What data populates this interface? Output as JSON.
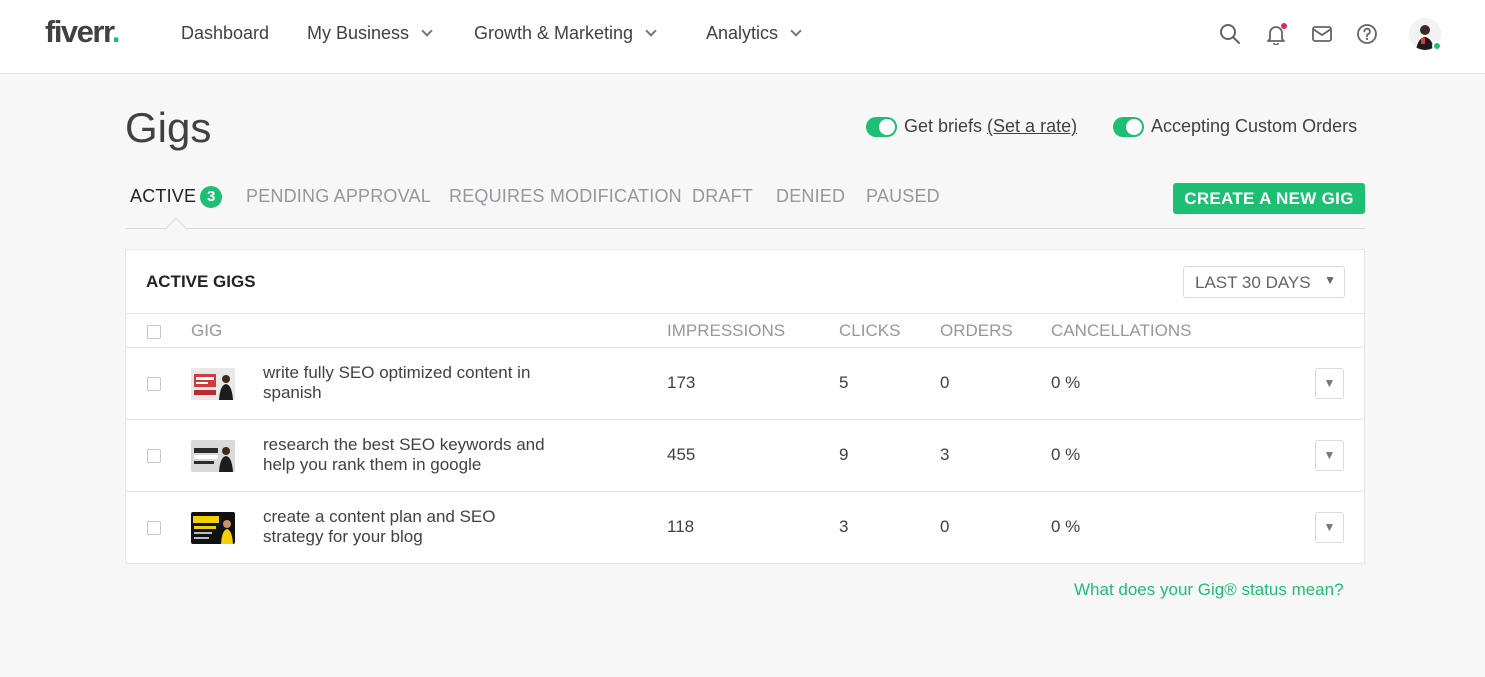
{
  "nav": {
    "logo_text": "fiverr",
    "logo_dot": ".",
    "items": [
      {
        "label": "Dashboard"
      },
      {
        "label": "My Business"
      },
      {
        "label": "Growth & Marketing"
      },
      {
        "label": "Analytics"
      }
    ],
    "icons": [
      "search-icon",
      "bell-icon",
      "mail-icon",
      "help-icon"
    ]
  },
  "header": {
    "title": "Gigs",
    "get_briefs_label": "Get briefs",
    "set_rate_label": "(Set a rate)",
    "custom_orders_label": "Accepting Custom Orders"
  },
  "tabs": [
    {
      "label": "ACTIVE",
      "count": "3"
    },
    {
      "label": "PENDING APPROVAL"
    },
    {
      "label": "REQUIRES MODIFICATION"
    },
    {
      "label": "DRAFT"
    },
    {
      "label": "DENIED"
    },
    {
      "label": "PAUSED"
    }
  ],
  "create_button": "CREATE A NEW GIG",
  "panel": {
    "title": "ACTIVE GIGS",
    "range": "LAST 30 DAYS",
    "columns": [
      "GIG",
      "IMPRESSIONS",
      "CLICKS",
      "ORDERS",
      "CANCELLATIONS"
    ],
    "rows": [
      {
        "title": "write fully SEO optimized content in spanish",
        "impressions": "173",
        "clicks": "5",
        "orders": "0",
        "cancellations": "0 %"
      },
      {
        "title": "research the best SEO keywords and help you rank them in google",
        "impressions": "455",
        "clicks": "9",
        "orders": "3",
        "cancellations": "0 %"
      },
      {
        "title": "create a content plan and SEO strategy for your blog",
        "impressions": "118",
        "clicks": "3",
        "orders": "0",
        "cancellations": "0 %"
      }
    ]
  },
  "help_link": "What does your Gig® status mean?",
  "colors": {
    "accent": "#1dbf73",
    "text": "#404145",
    "muted": "#95979d",
    "notification": "#e3284e"
  }
}
